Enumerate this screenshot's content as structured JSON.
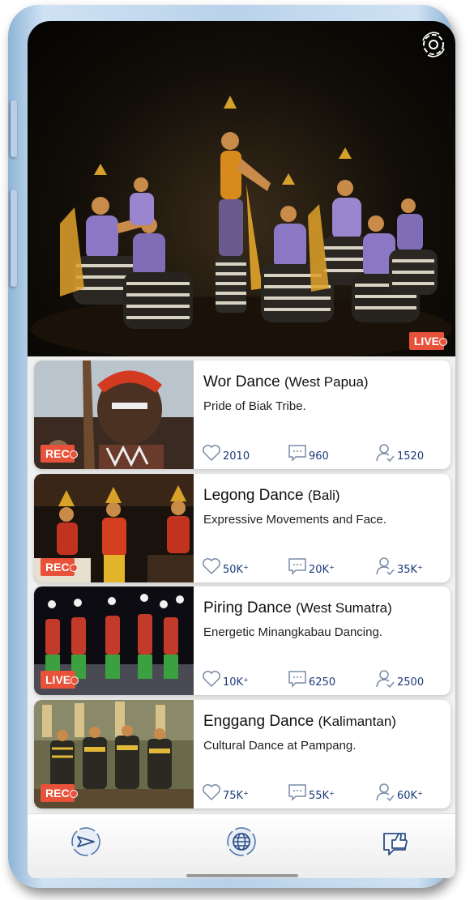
{
  "hero": {
    "status_badge": "LIVE",
    "settings_icon": "settings-refresh-icon"
  },
  "cards": [
    {
      "title": "Wor Dance",
      "region": "(West Papua)",
      "subtitle": "Pride of Biak Tribe.",
      "badge": "REC",
      "likes": "2010",
      "comments": "960",
      "viewers": "1520"
    },
    {
      "title": "Legong Dance",
      "region": "(Bali)",
      "subtitle": "Expressive Movements and Face.",
      "badge": "REC",
      "likes": "50K⁺",
      "comments": "20K⁺",
      "viewers": "35K⁺"
    },
    {
      "title": "Piring Dance",
      "region": "(West Sumatra)",
      "subtitle": "Energetic Minangkabau Dancing.",
      "badge": "LIVE",
      "likes": "10K⁺",
      "comments": "6250",
      "viewers": "2500"
    },
    {
      "title": "Enggang Dance",
      "region": "(Kalimantan)",
      "subtitle": "Cultural Dance at Pampang.",
      "badge": "REC",
      "likes": "75K⁺",
      "comments": "55K⁺",
      "viewers": "60K⁺"
    }
  ],
  "navbar": {
    "items": [
      "send-icon",
      "globe-icon",
      "thumbs-up-icon"
    ]
  },
  "colors": {
    "badge": "#e9523a",
    "stat_text": "#1b3a7a"
  }
}
